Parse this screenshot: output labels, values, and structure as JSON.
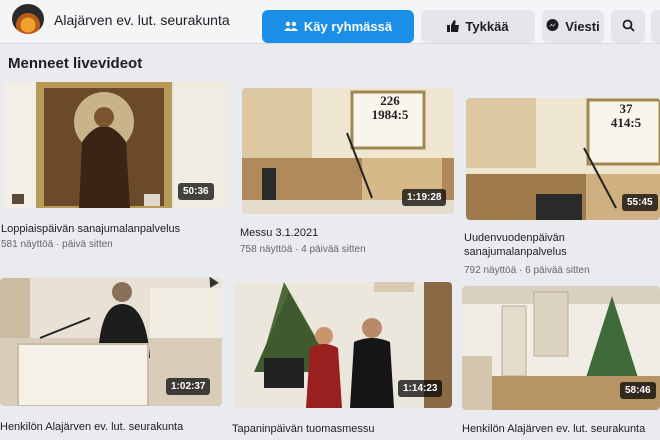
{
  "header": {
    "page_name": "Alajärven ev. lut. seurakunta",
    "join_group_label": "Käy ryhmässä",
    "like_label": "Tykkää",
    "message_label": "Viesti",
    "icons": {
      "group": "group-icon",
      "like": "thumbs-up-icon",
      "message": "messenger-icon",
      "search": "search-icon"
    }
  },
  "section": {
    "title": "Menneet livevideot"
  },
  "videos": [
    {
      "title": "Loppiaispäivän sanajumalanpalvelus",
      "meta": "581 näyttöä · päivä sitten",
      "duration": "50:36"
    },
    {
      "title": "Messu 3.1.2021",
      "meta": "758 näyttöä · 4 päivää sitten",
      "duration": "1:19:28",
      "hymn_numbers": "226\n1984:5"
    },
    {
      "title_line1": "Uudenvuodenpäivän",
      "title_line2": "sanajumalanpalvelus",
      "meta": "792 näyttöä · 6 päivää sitten",
      "duration": "55:45",
      "hymn_numbers": "37\n414:5"
    },
    {
      "title": "Henkilön Alajärven ev. lut. seurakunta",
      "duration": "1:02:37"
    },
    {
      "title": "Tapaninpäivän tuomasmessu",
      "duration": "1:14:23"
    },
    {
      "title": "Henkilön Alajärven ev. lut. seurakunta",
      "duration": "58:46"
    }
  ],
  "colors": {
    "primary": "#1b8fe8",
    "button_gray": "#e4e6eb",
    "background": "#e9ebee"
  }
}
